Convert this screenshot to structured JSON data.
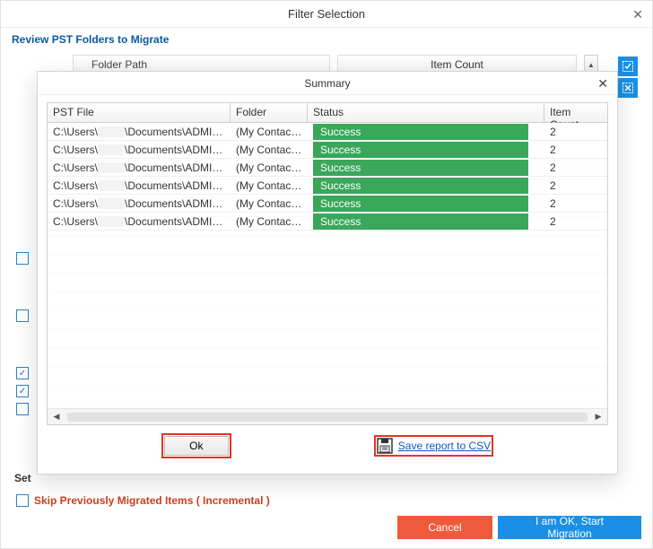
{
  "window": {
    "title": "Filter Selection",
    "subtitle": "Review PST Folders to Migrate",
    "back_headers": {
      "folder_path": "Folder Path",
      "item_count": "Item Count"
    },
    "settings_label": "Set",
    "skip_label": "Skip Previously Migrated Items ( Incremental )",
    "cancel_label": "Cancel",
    "start_label": "I am OK, Start Migration"
  },
  "dialog": {
    "title": "Summary",
    "headers": {
      "file": "PST File",
      "folder": "Folder",
      "status": "Status",
      "count": "Item Count"
    },
    "rows": [
      {
        "file_pre": "C:\\Users\\",
        "file_post": "\\Documents\\ADMINI...",
        "folder": "(My Contacts)",
        "status": "Success",
        "count": "2"
      },
      {
        "file_pre": "C:\\Users\\",
        "file_post": "\\Documents\\ADMINI...",
        "folder": "(My Contacts)",
        "status": "Success",
        "count": "2"
      },
      {
        "file_pre": "C:\\Users\\",
        "file_post": "\\Documents\\ADMINI...",
        "folder": "(My Contacts)",
        "status": "Success",
        "count": "2"
      },
      {
        "file_pre": "C:\\Users\\",
        "file_post": "\\Documents\\ADMINI...",
        "folder": "(My Contacts)",
        "status": "Success",
        "count": "2"
      },
      {
        "file_pre": "C:\\Users\\",
        "file_post": "\\Documents\\ADMINI...",
        "folder": "(My Contacts)",
        "status": "Success",
        "count": "2"
      },
      {
        "file_pre": "C:\\Users\\",
        "file_post": "\\Documents\\ADMINI...",
        "folder": "(My Contacts)",
        "status": "Success",
        "count": "2"
      }
    ],
    "ok_label": "Ok",
    "save_label": "Save report to CSV"
  },
  "left_checks": {
    "group1": [
      false,
      false
    ],
    "group2": [
      true,
      true,
      false
    ]
  }
}
